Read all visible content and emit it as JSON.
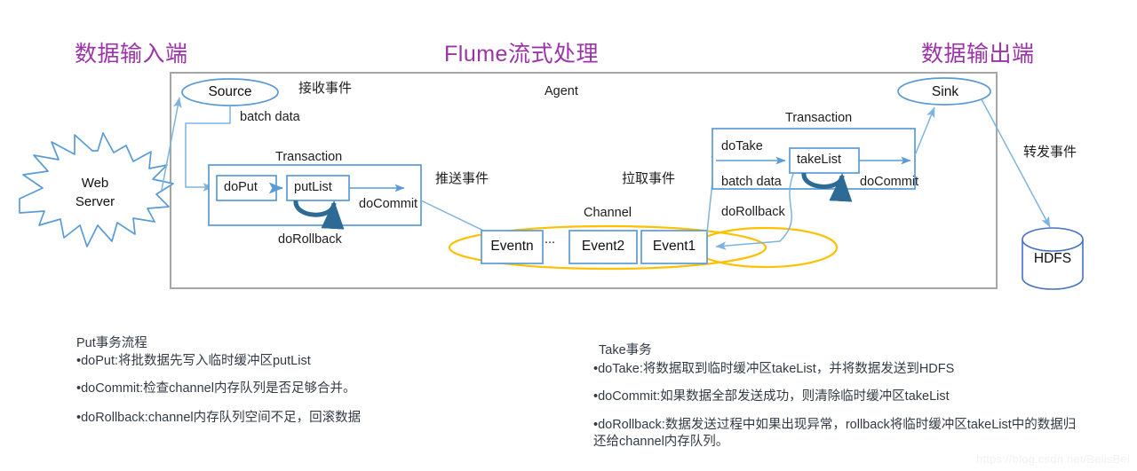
{
  "headings": {
    "left": "数据输入端",
    "center": "Flume流式处理",
    "right": "数据输出端",
    "color": "#9b34a8"
  },
  "diagram": {
    "agent_label": "Agent",
    "channel_label": "Channel",
    "nodes": {
      "web_server": "Web\nServer",
      "source": "Source",
      "sink": "Sink",
      "hdfs": "HDFS"
    },
    "put_transaction": {
      "title": "Transaction",
      "do_put": "doPut",
      "put_list": "putList",
      "do_commit": "doCommit",
      "do_rollback": "doRollback"
    },
    "take_transaction": {
      "title": "Transaction",
      "do_take": "doTake",
      "take_list": "takeList",
      "batch_data": "batch data",
      "do_commit": "doCommit",
      "do_rollback": "doRollback"
    },
    "events": {
      "event_n": "Eventn",
      "ellipsis": "...",
      "event_2": "Event2",
      "event_1": "Event1"
    },
    "edge_labels": {
      "receive_event": "接收事件",
      "batch_data_left": "batch data",
      "push_event": "推送事件",
      "pull_event": "拉取事件",
      "forward_event": "转发事件"
    },
    "colors": {
      "blue_stroke": "#5b9bd5",
      "dark_blue_arrow": "#2e6a96",
      "yellow_channel": "#ffc000",
      "agent_border": "#a6a6a6"
    }
  },
  "notes": {
    "put": {
      "heading": "Put事务流程",
      "lines": [
        "•doPut:将批数据先写入临时缓冲区putList",
        "•doCommit:检查channel内存队列是否足够合并。",
        "•doRollback:channel内存队列空间不足，回滚数据"
      ]
    },
    "take": {
      "heading": "Take事务",
      "lines": [
        "•doTake:将数据取到临时缓冲区takeList，并将数据发送到HDFS",
        "•doCommit:如果数据全部发送成功，则清除临时缓冲区takeList",
        "•doRollback:数据发送过程中如果出现异常，rollback将临时缓冲区takeList中的数据归还给channel内存队列。"
      ]
    }
  },
  "watermark": "https://blog.csdn.net/BeiisBei"
}
